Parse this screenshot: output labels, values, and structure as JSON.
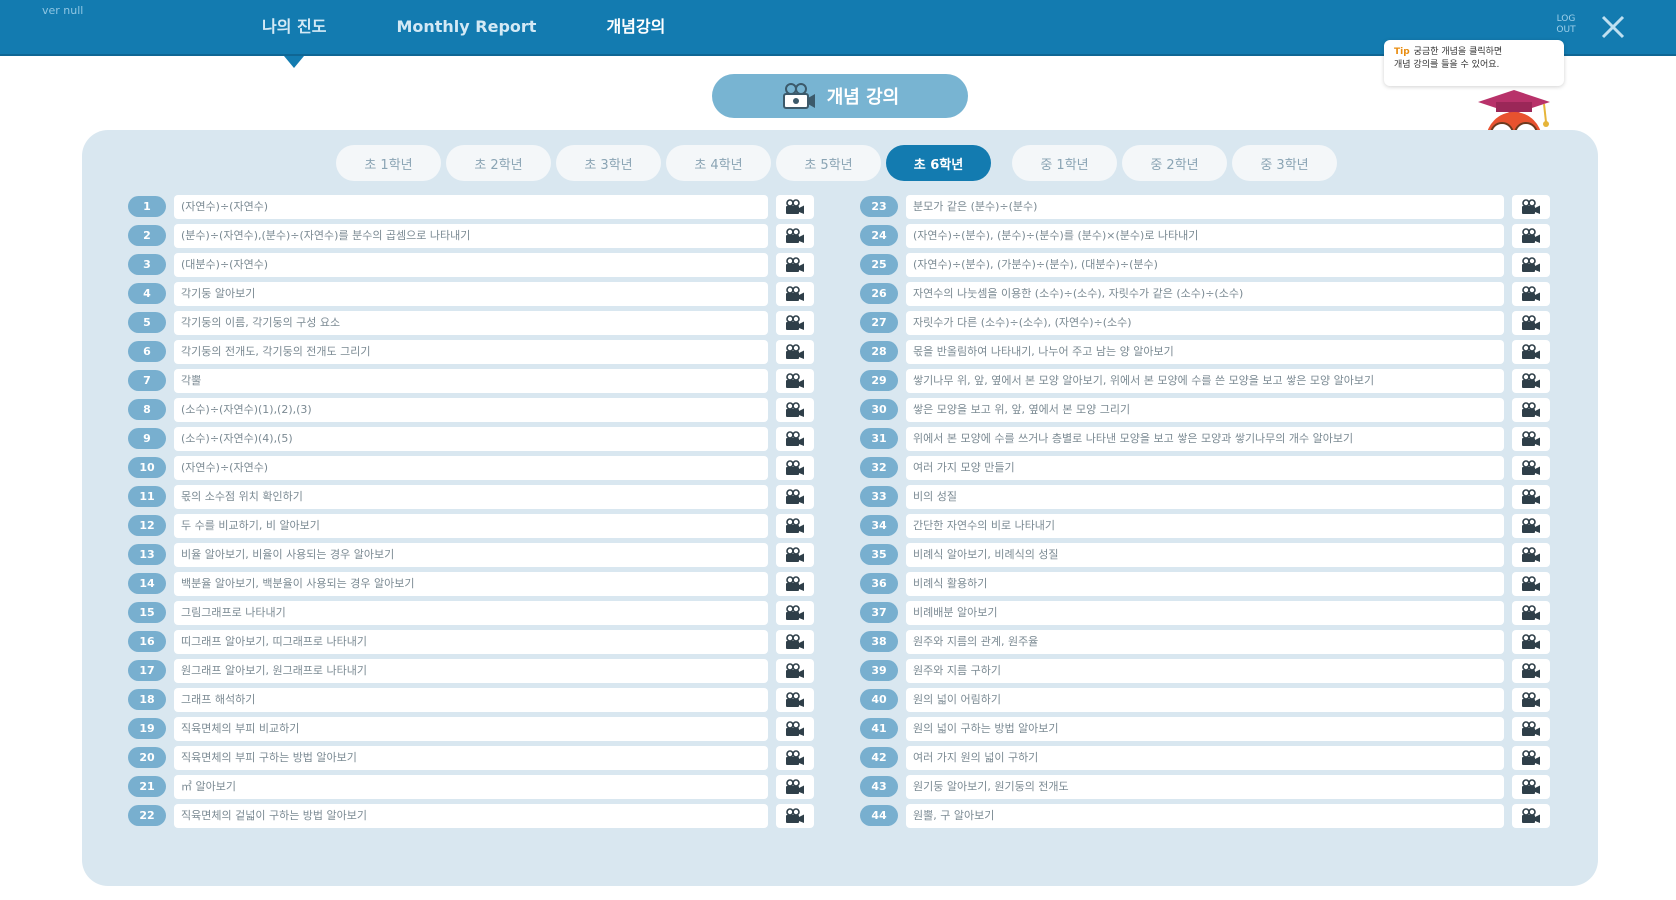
{
  "header": {
    "version": "ver null",
    "tabs": [
      {
        "label": "나의 진도"
      },
      {
        "label": "Monthly Report"
      },
      {
        "label": "개념강의"
      }
    ],
    "logout": "LOG OUT"
  },
  "tip": {
    "label": "Tip",
    "line1": "궁금한 개념을 클릭하면",
    "line2": "개념 강의를 들을 수 있어요."
  },
  "title": "개념 강의",
  "grades": [
    {
      "label": "초 1학년"
    },
    {
      "label": "초 2학년"
    },
    {
      "label": "초 3학년"
    },
    {
      "label": "초 4학년"
    },
    {
      "label": "초 5학년"
    },
    {
      "label": "초 6학년"
    },
    {
      "label": "중 1학년"
    },
    {
      "label": "중 2학년"
    },
    {
      "label": "중 3학년"
    }
  ],
  "lessons_left": [
    {
      "num": "1",
      "title": "(자연수)÷(자연수)"
    },
    {
      "num": "2",
      "title": "(분수)÷(자연수),(분수)÷(자연수)를 분수의 곱셈으로 나타내기"
    },
    {
      "num": "3",
      "title": "(대분수)÷(자연수)"
    },
    {
      "num": "4",
      "title": "각기둥 알아보기"
    },
    {
      "num": "5",
      "title": "각기둥의 이름, 각기둥의 구성 요소"
    },
    {
      "num": "6",
      "title": "각기둥의 전개도, 각기둥의 전개도 그리기"
    },
    {
      "num": "7",
      "title": "각뿔"
    },
    {
      "num": "8",
      "title": "(소수)÷(자연수)(1),(2),(3)"
    },
    {
      "num": "9",
      "title": "(소수)÷(자연수)(4),(5)"
    },
    {
      "num": "10",
      "title": "(자연수)÷(자연수)"
    },
    {
      "num": "11",
      "title": "몫의 소수점 위치 확인하기"
    },
    {
      "num": "12",
      "title": "두 수를 비교하기, 비 알아보기"
    },
    {
      "num": "13",
      "title": "비율 알아보기, 비율이 사용되는 경우 알아보기"
    },
    {
      "num": "14",
      "title": "백분율 알아보기, 백분율이 사용되는 경우 알아보기"
    },
    {
      "num": "15",
      "title": "그림그래프로 나타내기"
    },
    {
      "num": "16",
      "title": "띠그래프 알아보기, 띠그래프로 나타내기"
    },
    {
      "num": "17",
      "title": "원그래프 알아보기, 원그래프로 나타내기"
    },
    {
      "num": "18",
      "title": "그래프 해석하기"
    },
    {
      "num": "19",
      "title": "직육면체의 부피 비교하기"
    },
    {
      "num": "20",
      "title": "직육면체의 부피 구하는 방법 알아보기"
    },
    {
      "num": "21",
      "title": "㎥ 알아보기"
    },
    {
      "num": "22",
      "title": "직육면체의 겉넓이 구하는 방법 알아보기"
    }
  ],
  "lessons_right": [
    {
      "num": "23",
      "title": "분모가 같은 (분수)÷(분수)"
    },
    {
      "num": "24",
      "title": "(자연수)÷(분수), (분수)÷(분수)를 (분수)×(분수)로 나타내기"
    },
    {
      "num": "25",
      "title": "(자연수)÷(분수), (가분수)÷(분수), (대분수)÷(분수)"
    },
    {
      "num": "26",
      "title": "자연수의 나눗셈을 이용한 (소수)÷(소수), 자릿수가 같은 (소수)÷(소수)"
    },
    {
      "num": "27",
      "title": "자릿수가 다른 (소수)÷(소수), (자연수)÷(소수)"
    },
    {
      "num": "28",
      "title": "몫을 반올림하여 나타내기, 나누어 주고 남는 양 알아보기"
    },
    {
      "num": "29",
      "title": "쌓기나무 위, 앞, 옆에서 본 모양 알아보기, 위에서 본 모양에 수를 쓴 모양을 보고 쌓은 모양 알아보기"
    },
    {
      "num": "30",
      "title": "쌓은 모양을 보고 위, 앞, 옆에서 본 모양 그리기"
    },
    {
      "num": "31",
      "title": "위에서 본 모양에 수를 쓰거나 층별로 나타낸 모양을 보고 쌓은 모양과 쌓기나무의 개수 알아보기"
    },
    {
      "num": "32",
      "title": "여러 가지 모양 만들기"
    },
    {
      "num": "33",
      "title": "비의 성질"
    },
    {
      "num": "34",
      "title": "간단한 자연수의 비로 나타내기"
    },
    {
      "num": "35",
      "title": "비례식 알아보기, 비례식의 성질"
    },
    {
      "num": "36",
      "title": "비례식 활용하기"
    },
    {
      "num": "37",
      "title": "비례배분 알아보기"
    },
    {
      "num": "38",
      "title": "원주와 지름의 관계, 원주율"
    },
    {
      "num": "39",
      "title": "원주와 지름 구하기"
    },
    {
      "num": "40",
      "title": "원의 넓이 어림하기"
    },
    {
      "num": "41",
      "title": "원의 넓이 구하는 방법 알아보기"
    },
    {
      "num": "42",
      "title": "여러 가지 원의 넓이 구하기"
    },
    {
      "num": "43",
      "title": "원기둥 알아보기, 원기둥의 전개도"
    },
    {
      "num": "44",
      "title": "원뿔, 구 알아보기"
    }
  ]
}
